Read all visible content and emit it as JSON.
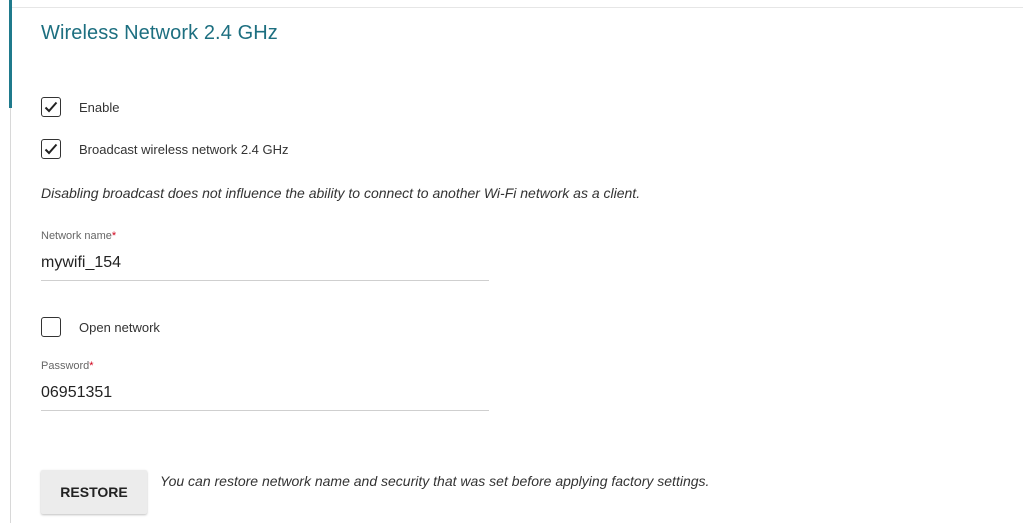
{
  "section": {
    "title": "Wireless Network 2.4 GHz"
  },
  "options": {
    "enable": {
      "label": "Enable",
      "checked": true
    },
    "broadcast": {
      "label": "Broadcast wireless network 2.4 GHz",
      "checked": true
    },
    "open_network": {
      "label": "Open network",
      "checked": false
    }
  },
  "broadcast_note": "Disabling broadcast does not influence the ability to connect to another Wi-Fi network as a client.",
  "network_name": {
    "label": "Network name",
    "required_mark": "*",
    "value": "mywifi_154"
  },
  "password": {
    "label": "Password",
    "required_mark": "*",
    "value": "06951351"
  },
  "restore": {
    "button_label": "RESTORE",
    "note": "You can restore network name and security that was set before applying factory settings."
  },
  "colors": {
    "title": "#1d6f80",
    "accent_bar": "#1f7a8c",
    "required": "#d0021b"
  },
  "icons": {
    "checked": "checkmark-icon"
  }
}
